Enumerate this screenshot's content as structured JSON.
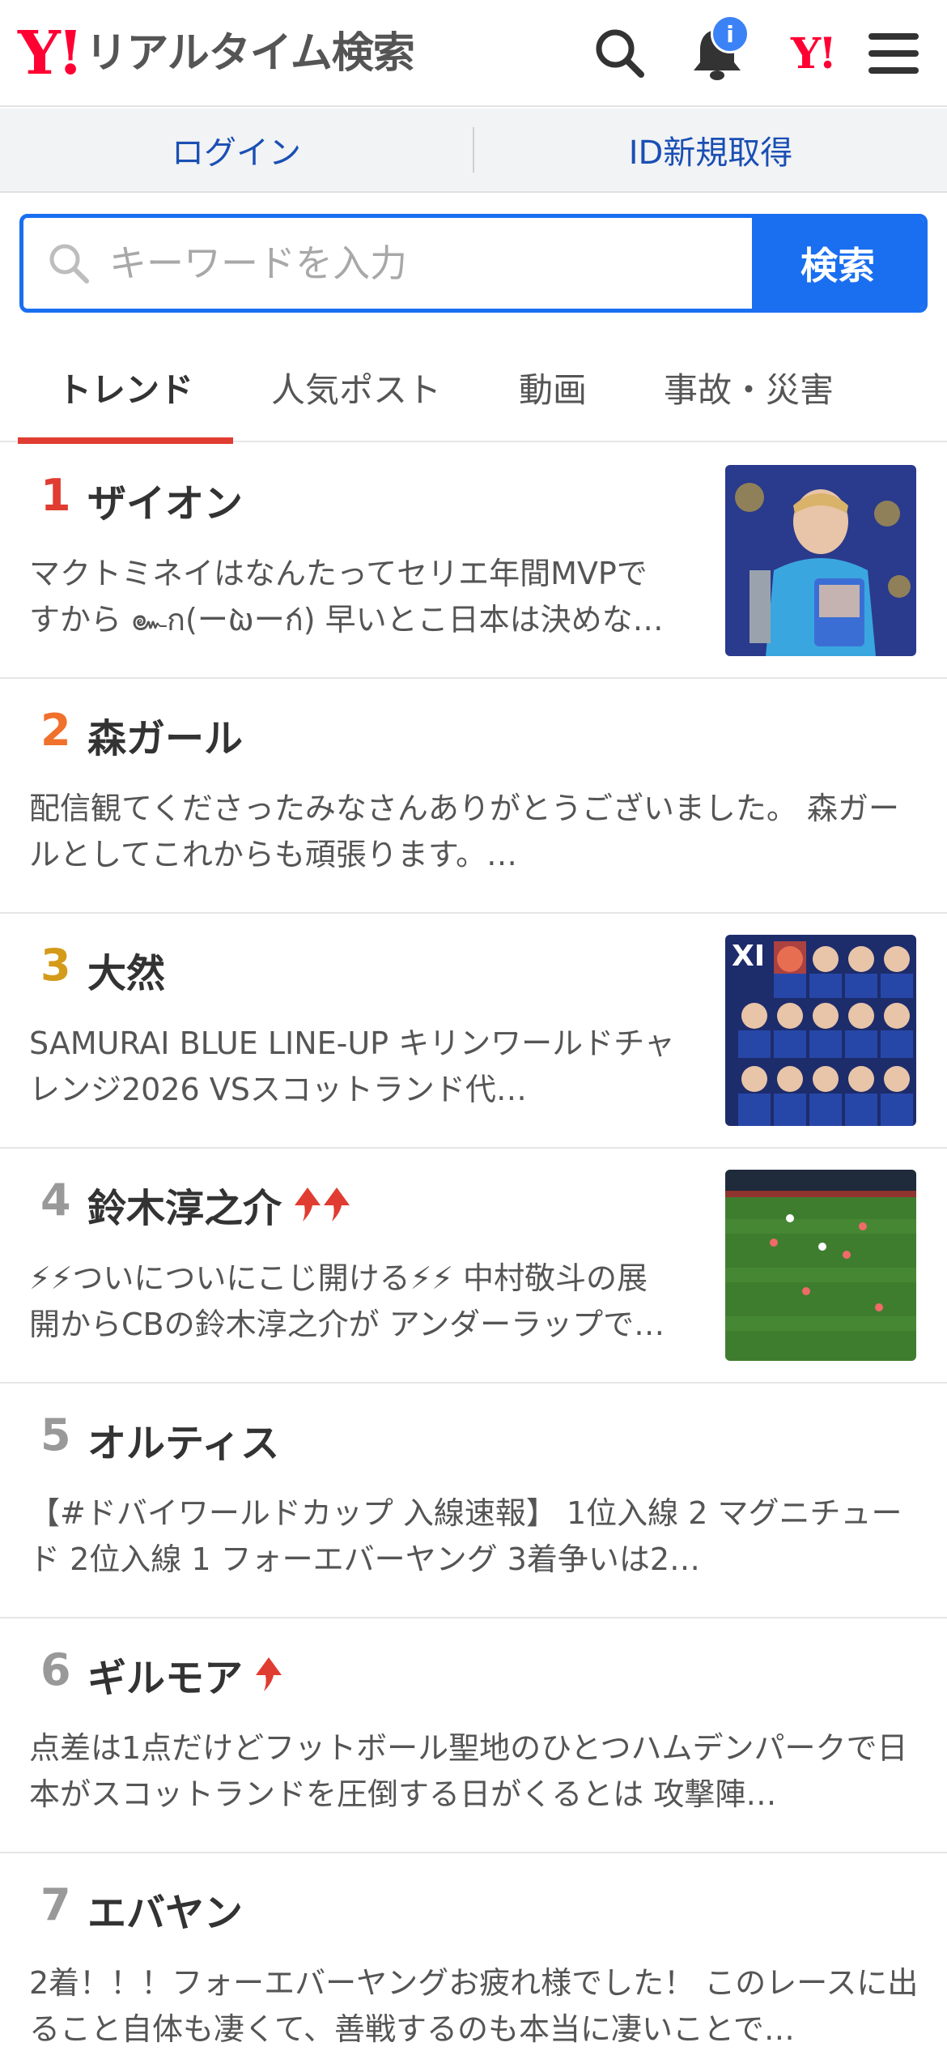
{
  "header": {
    "logo_mark": "Y!",
    "logo_text": "リアルタイム検索",
    "notification_badge": "i",
    "yj_mark": "Y!"
  },
  "loginbar": {
    "login": "ログイン",
    "register": "ID新規取得"
  },
  "search": {
    "placeholder": "キーワードを入力",
    "button": "検索"
  },
  "tabs": [
    "トレンド",
    "人気ポスト",
    "動画",
    "事故・災害"
  ],
  "colors": {
    "accent_blue": "#1a6ff0",
    "brand_red": "#ff0033",
    "tab_underline": "#e03c31",
    "rank1": "#e03c31",
    "rank2": "#f0702c",
    "rank3": "#d49a1a",
    "rank_other": "#999999",
    "up_arrow": "#e03c31"
  },
  "trends": [
    {
      "rank": "1",
      "word": "ザイオン",
      "arrows": 0,
      "desc": "マクトミネイはなんたってセリエ年間MVPですから‎ ๛ก(ー̀ωー́ก) 早いとこ日本は決めないと…",
      "thumb": "photo-soccer-mvp"
    },
    {
      "rank": "2",
      "word": "森ガール",
      "arrows": 0,
      "desc": "配信観てくださったみなさんありがとうございました。 森ガールとしてこれからも頑張ります。…",
      "thumb": ""
    },
    {
      "rank": "3",
      "word": "大然",
      "arrows": 0,
      "desc": "SAMURAI BLUE LINE-UP キリンワールドチャレンジ2026 VSスコットランド代…",
      "thumb": "photo-lineup"
    },
    {
      "rank": "4",
      "word": "鈴木淳之介",
      "arrows": 2,
      "desc": "⚡⚡ついについにこじ開ける⚡⚡ 中村敬斗の展開からCBの鈴木淳之介が アンダーラップで…",
      "thumb": "photo-match"
    },
    {
      "rank": "5",
      "word": "オルティス",
      "arrows": 0,
      "desc": "【#ドバイワールドカップ 入線速報】 1位入線 2 マグニチュード 2位入線 1 フォーエバーヤング 3着争いは2…",
      "thumb": ""
    },
    {
      "rank": "6",
      "word": "ギルモア",
      "arrows": 1,
      "desc": "点差は1点だけどフットボール聖地のひとつハムデンパークで日本がスコットランドを圧倒する日がくるとは 攻撃陣…",
      "thumb": ""
    },
    {
      "rank": "7",
      "word": "エバヤン",
      "arrows": 0,
      "desc": "2着！！！フォーエバーヤングお疲れ様でした！ このレースに出ること自体も凄くて、善戦するのも本当に凄いことで…",
      "thumb": ""
    }
  ]
}
